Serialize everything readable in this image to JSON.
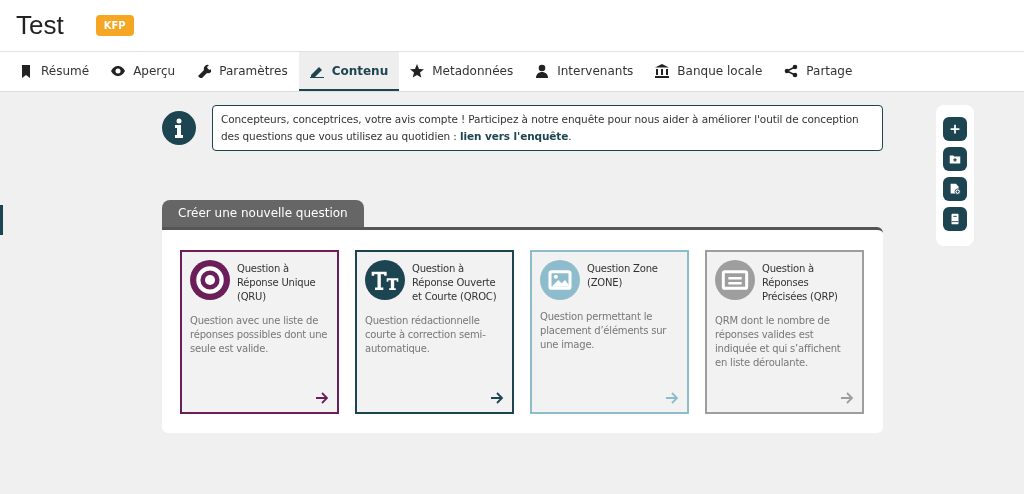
{
  "header": {
    "title": "Test",
    "badge": "KFP"
  },
  "tabs": [
    {
      "label": "Résumé",
      "kind": "bookmark",
      "selected": false
    },
    {
      "label": "Aperçu",
      "kind": "eye",
      "selected": false
    },
    {
      "label": "Paramètres",
      "kind": "wrench",
      "selected": false
    },
    {
      "label": "Contenu",
      "kind": "pen",
      "selected": true
    },
    {
      "label": "Metadonnées",
      "kind": "star",
      "selected": false
    },
    {
      "label": "Intervenants",
      "kind": "person",
      "selected": false
    },
    {
      "label": "Banque locale",
      "kind": "bank",
      "selected": false
    },
    {
      "label": "Partage",
      "kind": "share",
      "selected": false
    }
  ],
  "notice": {
    "text": "Concepteurs, conceptrices, votre avis compte ! Participez à notre enquête pour nous aider à améliorer l'outil de conception des questions que vous utilisez au quotidien : ",
    "link": "lien vers l'enquête",
    "after": "."
  },
  "create_panel": {
    "tab": "Créer une nouvelle question",
    "cards": [
      {
        "title": "Question à Réponse Unique (QRU)",
        "description": "Question avec une liste de réponses possibles dont une seule est valide.",
        "color": "#6b1f5a",
        "kind": "radio"
      },
      {
        "title": "Question à Réponse Ouverte et Courte (QROC)",
        "description": "Question rédactionnelle courte à correction semi-automatique.",
        "color": "#1d4451",
        "kind": "text"
      },
      {
        "title": "Question Zone (ZONE)",
        "description": "Question permettant le placement d’éléments sur une image.",
        "color": "#8fbccc",
        "kind": "image"
      },
      {
        "title": "Question à Réponses Précisées (QRP)",
        "description": "QRM dont le nombre de réponses valides est indiquée et qui s’affichent en liste déroulante.",
        "color": "#9e9e9e",
        "kind": "list"
      }
    ]
  },
  "toolbar": [
    {
      "kind": "plus"
    },
    {
      "kind": "folder-plus"
    },
    {
      "kind": "file-plus"
    },
    {
      "kind": "book"
    }
  ]
}
